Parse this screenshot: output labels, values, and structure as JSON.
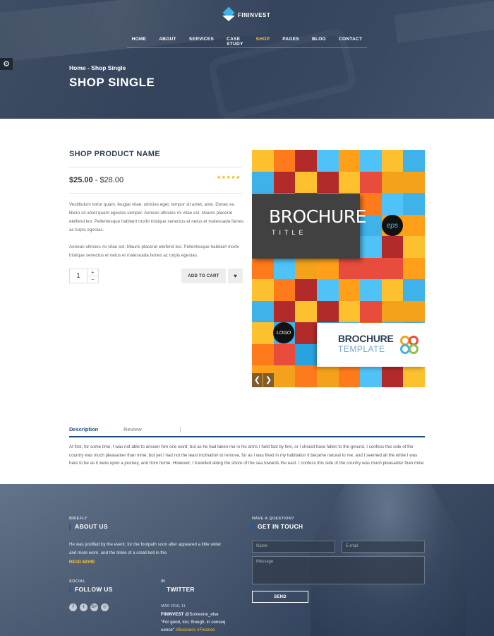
{
  "brand": {
    "name": "FININVEST"
  },
  "nav": [
    "HOME",
    "ABOUT",
    "SERVICES",
    "CASE STUDY",
    "SHOP",
    "PAGES",
    "BLOG",
    "CONTACT"
  ],
  "nav_active": "SHOP",
  "breadcrumb": "Home - Shop Single",
  "hero_title": "SHOP SINGLE",
  "product": {
    "name": "SHOP PRODUCT NAME",
    "price_from": "$25.00",
    "price_sep": " - ",
    "price_to": "$28.00",
    "stars": "★★★★★",
    "desc1": "Vestibulum tortor quam, feugiat vitae, ultricies eget, tempor sit amet, ante. Donec eu libero sit amet quam egestas semper. Aenean ultricies mi vitae est. Mauris placerat eleifend leo. Pellentesque habitant morbi tristique senectus et netus et malesuada fames ac turpis egestas.",
    "desc2": "Aenean ultricies mi vitae est. Mauris placerat eleifend leo. Pellentesque habitant morbi tristique senectus et netus et malesuada fames ac turpis egestas.",
    "quantity": "1",
    "qty_plus": "+",
    "qty_minus": "−",
    "add_to_cart": "ADD TO CART",
    "wishlist_glyph": "♥"
  },
  "brochure": {
    "title_big": "BROCHURE",
    "title_small": "TITLE",
    "badge": "eps",
    "logo": "LOGO",
    "template_line1": "BROCHURE",
    "template_line2": "TEMPLATE",
    "prev_glyph": "❮",
    "next_glyph": "❯"
  },
  "tabs": {
    "description": "Description",
    "review": "Review"
  },
  "description_text": "At first, for some time, I was not able to answer him one word; but as he had taken me in his arms I held fast by him, or I should have fallen to the ground. I confess this side of the country was much pleasanter than mine; but yet I had not the least inclination to remove, for as I was fixed in my habitation it became natural to me, and I seemed all the while I was here to be as it were upon a journey, and from home. However, I travelled along the shore of the sea towards the east. I confess this side of the country was much pleasanter than mine",
  "footer": {
    "about_small": "BRIEFLY",
    "about_head": "ABOUT US",
    "about_text": "He was justified by the event; for the footpath soon after appeared a little wider and more worn, and the tinkle of a small bell in the.",
    "read_more": "READ MORE",
    "social_small": "SOCIAL",
    "social_head": "FOLLOW US",
    "social_icons": [
      "f",
      "t",
      "G+",
      "◎"
    ],
    "tw_small": "IN",
    "tw_head": "TWITTER",
    "tw_date": "MAR 2016, 11",
    "tw_author": "FININVEST",
    "tw_handle": " @Someone_else",
    "tw_text": "\"For good, too; though, in conseq uence\"",
    "tw_tags": " #Business #Finance",
    "contact_small": "HAVE A QUESTION?",
    "contact_head": "GET IN TOUCH",
    "name_placeholder": "Name",
    "email_placeholder": "E-mail",
    "message_placeholder": "Message",
    "send": "SEND"
  },
  "colors": {
    "accent_yellow": "#f4c430",
    "accent_blue": "#1e4b80"
  }
}
